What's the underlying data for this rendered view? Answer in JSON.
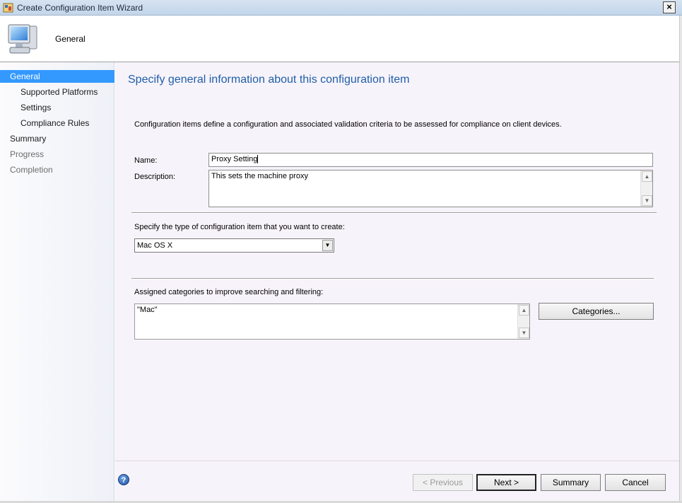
{
  "window": {
    "title": "Create Configuration Item Wizard",
    "close_label": "×"
  },
  "header": {
    "title": "General"
  },
  "sidebar": {
    "items": [
      {
        "label": "General",
        "state": "active"
      },
      {
        "label": "Supported Platforms",
        "state": "sub"
      },
      {
        "label": "Settings",
        "state": "sub"
      },
      {
        "label": "Compliance Rules",
        "state": "sub"
      },
      {
        "label": "Summary",
        "state": "normal"
      },
      {
        "label": "Progress",
        "state": "disabled"
      },
      {
        "label": "Completion",
        "state": "disabled"
      }
    ]
  },
  "main": {
    "heading": "Specify general information about this configuration item",
    "intro": "Configuration items define a configuration and associated validation criteria to be assessed for compliance on client devices.",
    "name_label": "Name:",
    "name_value": "Proxy Setting",
    "description_label": "Description:",
    "description_value": "This sets the machine proxy",
    "type_label": "Specify the type of configuration item that you want to create:",
    "type_selected": "Mac OS X",
    "categories_label": "Assigned categories to improve searching and filtering:",
    "categories_value": "\"Mac\"",
    "categories_button": "Categories..."
  },
  "footer": {
    "help_icon": "?",
    "previous_label": "< Previous",
    "next_label": "Next >",
    "summary_label": "Summary",
    "cancel_label": "Cancel"
  },
  "colors": {
    "accent": "#3399ff",
    "heading": "#1f5fa8",
    "content_bg": "#f7f3fa"
  }
}
